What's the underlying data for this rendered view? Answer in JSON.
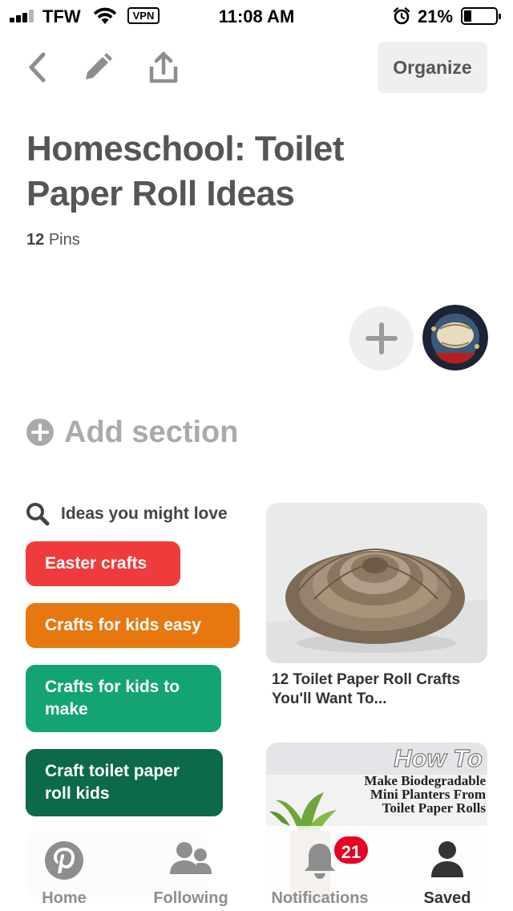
{
  "status_bar": {
    "carrier": "TFW",
    "vpn_label": "VPN",
    "time": "11:08 AM",
    "battery_percent": "21%",
    "battery_level": 0.21,
    "signal_bars": 3,
    "icons": [
      "signal-icon",
      "wifi-icon",
      "alarm-icon",
      "battery-icon"
    ]
  },
  "toolbar": {
    "back_icon": "chevron-left-icon",
    "edit_icon": "pencil-icon",
    "share_icon": "share-icon",
    "organize_label": "Organize"
  },
  "board": {
    "title": "Homeschool: Toilet Paper Roll Ideas",
    "pin_count": "12",
    "pin_count_label": "Pins",
    "add_section_label": "Add section"
  },
  "ideas": {
    "header": "Ideas you might love",
    "chips": [
      {
        "label": "Easter crafts",
        "color": "#ef3b3b"
      },
      {
        "label": "Crafts for kids easy",
        "color": "#e6780f"
      },
      {
        "label": "Crafts for kids to make",
        "color": "#13a472"
      },
      {
        "label": "Craft toilet paper roll kids",
        "color": "#0c694b"
      }
    ]
  },
  "pins": [
    {
      "caption": "12 Toilet Paper Roll Crafts You'll Want To..."
    },
    {
      "image_text_1": "How To",
      "image_text_2": "Make Biodegradable",
      "image_text_3": "Mini Planters From",
      "image_text_4": "Toilet Paper Rolls"
    }
  ],
  "bottom_nav": {
    "items": [
      {
        "label": "Home",
        "icon": "pinterest-logo-icon"
      },
      {
        "label": "Following",
        "icon": "people-icon"
      },
      {
        "label": "Notifications",
        "icon": "bell-icon"
      },
      {
        "label": "Saved",
        "icon": "person-icon"
      }
    ],
    "notifications_badge": "21",
    "active": "Saved"
  },
  "colors": {
    "accent_red": "#e60023",
    "title_gray": "#555555",
    "chip_gray_bg": "#efefef"
  }
}
